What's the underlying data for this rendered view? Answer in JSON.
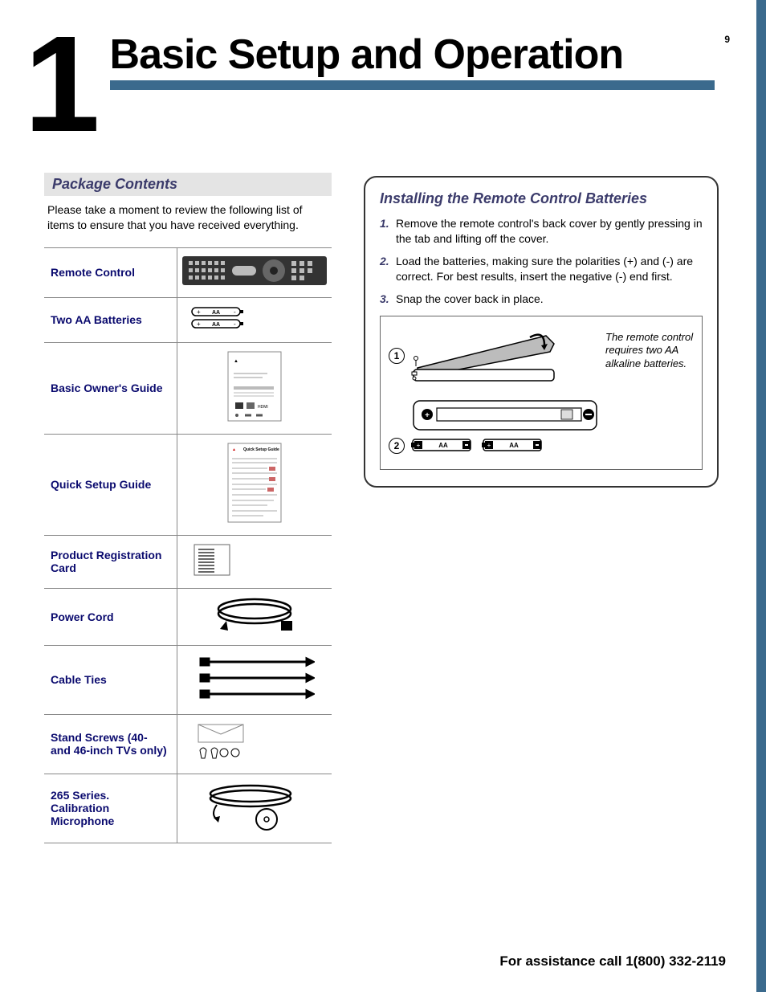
{
  "page_number": "9",
  "chapter": {
    "number": "1",
    "title": "Basic Setup and Operation"
  },
  "package": {
    "heading": "Package Contents",
    "intro": "Please take a moment to review the following list of items to ensure that you have received everything.",
    "items": [
      {
        "label": "Remote Control"
      },
      {
        "label": "Two AA Batteries"
      },
      {
        "label": "Basic Owner's Guide"
      },
      {
        "label": "Quick Setup Guide"
      },
      {
        "label": "Product Registration Card"
      },
      {
        "label": "Power Cord"
      },
      {
        "label": "Cable Ties"
      },
      {
        "label": "Stand Screws (40- and 46-inch TVs only)"
      },
      {
        "label": "265 Series.  Calibration Microphone"
      }
    ]
  },
  "install": {
    "title": "Installing the Remote Control Batteries",
    "steps": [
      {
        "n": "1.",
        "text": "Remove the remote control's back cover by gently pressing in the tab and lifting off the cover."
      },
      {
        "n": "2.",
        "text": "Load the batteries, making sure the polarities (+) and (-) are correct.  For best results, insert the negative (-) end first."
      },
      {
        "n": "3.",
        "text": "Snap the cover back in place."
      }
    ],
    "diagram": {
      "step1": "1",
      "step2": "2",
      "caption": "The remote control requires two AA alkaline batteries.",
      "battery_label": "AA"
    }
  },
  "footer": "For assistance call 1(800) 332-2119"
}
